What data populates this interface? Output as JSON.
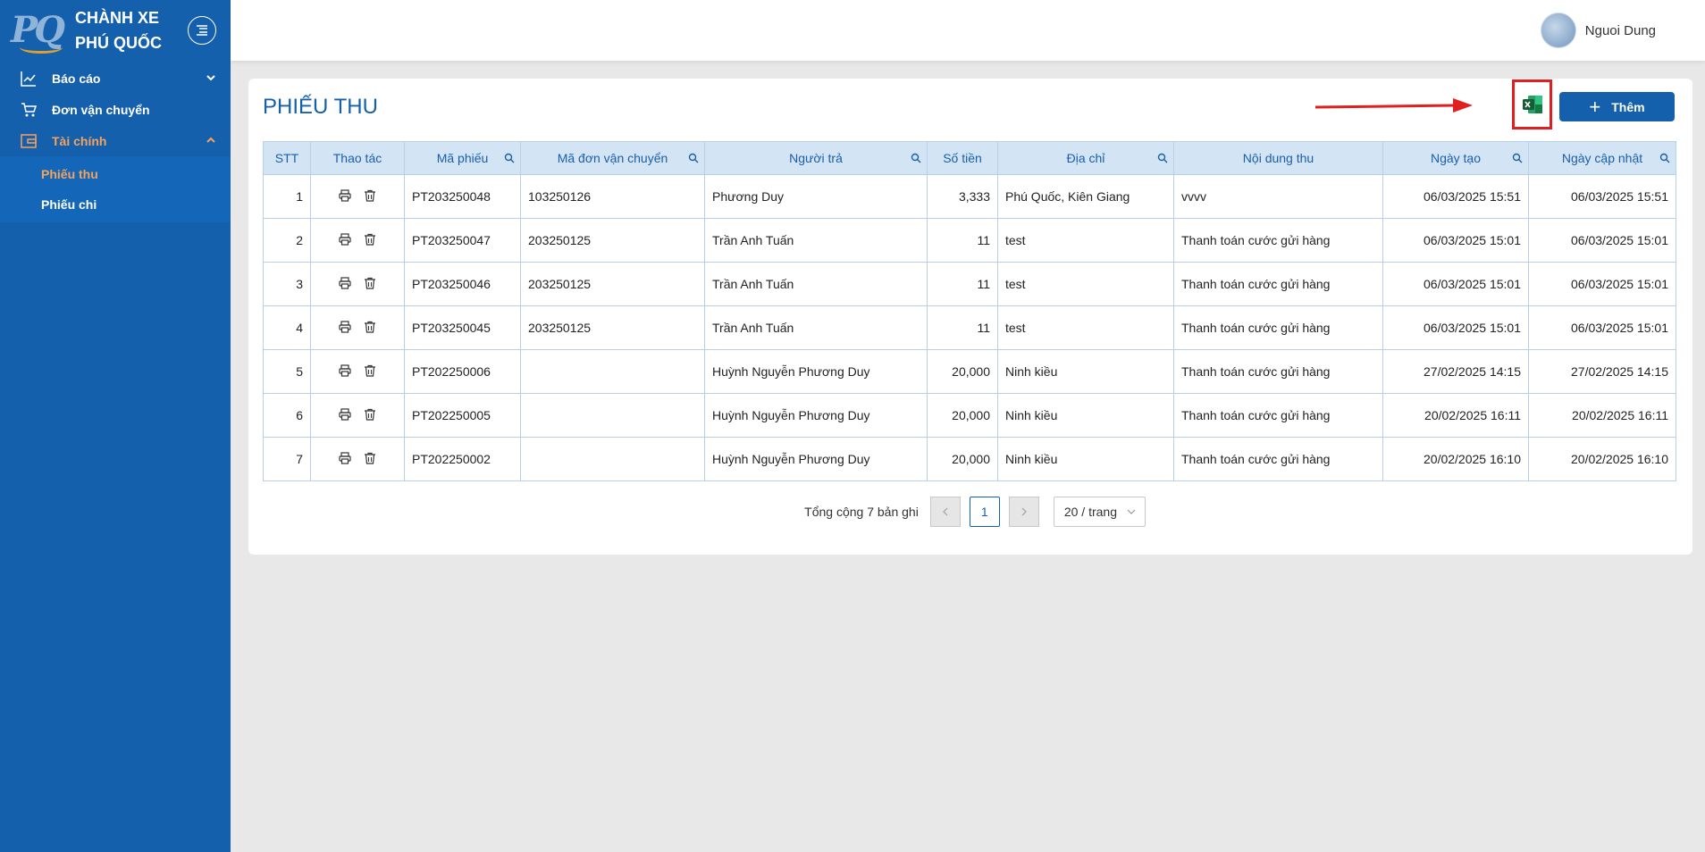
{
  "brand": {
    "line1": "CHÀNH XE",
    "line2": "PHÚ QUỐC",
    "logo_text": "PQ"
  },
  "sidebar": {
    "items": [
      {
        "label": "Báo cáo",
        "icon": "line-chart-icon",
        "expanded": false
      },
      {
        "label": "Đơn vận chuyển",
        "icon": "cart-icon"
      },
      {
        "label": "Tài chính",
        "icon": "wallet-icon",
        "expanded": true,
        "active": true
      }
    ],
    "submenu": [
      {
        "label": "Phiếu thu",
        "active": true
      },
      {
        "label": "Phiếu chi",
        "active": false
      }
    ]
  },
  "header": {
    "user_name": "Nguoi Dung"
  },
  "page": {
    "title": "PHIẾU THU",
    "add_label": "Thêm",
    "excel_icon": "excel-icon"
  },
  "table": {
    "columns": [
      "STT",
      "Thao tác",
      "Mã phiếu",
      "Mã đơn vận chuyển",
      "Người trả",
      "Số tiền",
      "Địa chỉ",
      "Nội dung thu",
      "Ngày tạo",
      "Ngày cập nhật"
    ],
    "rows": [
      {
        "stt": "1",
        "ma_phieu": "PT203250048",
        "ma_don": "103250126",
        "nguoi_tra": "Phương Duy",
        "so_tien": "3,333",
        "dia_chi": "Phú Quốc, Kiên Giang",
        "noi_dung": "vvvv",
        "ngay_tao": "06/03/2025 15:51",
        "ngay_cap_nhat": "06/03/2025 15:51"
      },
      {
        "stt": "2",
        "ma_phieu": "PT203250047",
        "ma_don": "203250125",
        "nguoi_tra": "Trần Anh Tuấn",
        "so_tien": "11",
        "dia_chi": "test",
        "noi_dung": "Thanh toán cước gửi hàng",
        "ngay_tao": "06/03/2025 15:01",
        "ngay_cap_nhat": "06/03/2025 15:01"
      },
      {
        "stt": "3",
        "ma_phieu": "PT203250046",
        "ma_don": "203250125",
        "nguoi_tra": "Trần Anh Tuấn",
        "so_tien": "11",
        "dia_chi": "test",
        "noi_dung": "Thanh toán cước gửi hàng",
        "ngay_tao": "06/03/2025 15:01",
        "ngay_cap_nhat": "06/03/2025 15:01"
      },
      {
        "stt": "4",
        "ma_phieu": "PT203250045",
        "ma_don": "203250125",
        "nguoi_tra": "Trần Anh Tuấn",
        "so_tien": "11",
        "dia_chi": "test",
        "noi_dung": "Thanh toán cước gửi hàng",
        "ngay_tao": "06/03/2025 15:01",
        "ngay_cap_nhat": "06/03/2025 15:01"
      },
      {
        "stt": "5",
        "ma_phieu": "PT202250006",
        "ma_don": "",
        "nguoi_tra": "Huỳnh Nguyễn Phương Duy",
        "so_tien": "20,000",
        "dia_chi": "Ninh kiều",
        "noi_dung": "Thanh toán cước gửi hàng",
        "ngay_tao": "27/02/2025 14:15",
        "ngay_cap_nhat": "27/02/2025 14:15"
      },
      {
        "stt": "6",
        "ma_phieu": "PT202250005",
        "ma_don": "",
        "nguoi_tra": "Huỳnh Nguyễn Phương Duy",
        "so_tien": "20,000",
        "dia_chi": "Ninh kiều",
        "noi_dung": "Thanh toán cước gửi hàng",
        "ngay_tao": "20/02/2025 16:11",
        "ngay_cap_nhat": "20/02/2025 16:11"
      },
      {
        "stt": "7",
        "ma_phieu": "PT202250002",
        "ma_don": "",
        "nguoi_tra": "Huỳnh Nguyễn Phương Duy",
        "so_tien": "20,000",
        "dia_chi": "Ninh kiều",
        "noi_dung": "Thanh toán cước gửi hàng",
        "ngay_tao": "20/02/2025 16:10",
        "ngay_cap_nhat": "20/02/2025 16:10"
      }
    ]
  },
  "pagination": {
    "total_text": "Tổng cộng 7 bản ghi",
    "current_page": "1",
    "page_size": "20 / trang"
  },
  "colors": {
    "primary": "#1560ad",
    "active_menu": "#f5a25d",
    "header_bg": "#d3e4f5",
    "highlight_box": "#e02020"
  }
}
